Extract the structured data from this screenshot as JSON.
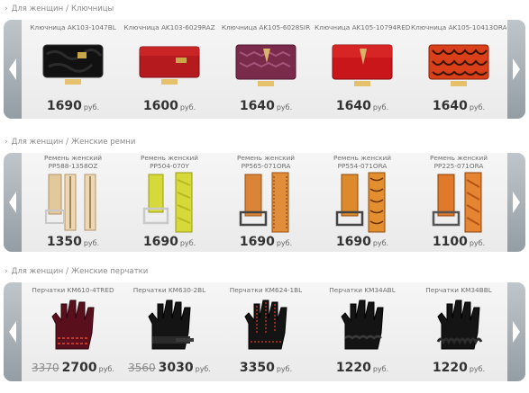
{
  "sections": [
    {
      "breadcrumb": [
        "Для женщин",
        "Ключницы"
      ],
      "items": [
        {
          "name": "Ключница AK103-1047BL",
          "price": "1690",
          "currency": "руб."
        },
        {
          "name": "Ключница AK103-6029RAZ",
          "price": "1600",
          "currency": "руб."
        },
        {
          "name": "Ключница AK105-6028SIR",
          "price": "1640",
          "currency": "руб."
        },
        {
          "name": "Ключница AK105-10794RED",
          "price": "1640",
          "currency": "руб."
        },
        {
          "name": "Ключница AK105-10413ORA",
          "price": "1640",
          "currency": "руб."
        }
      ]
    },
    {
      "breadcrumb": [
        "Для женщин",
        "Женские ремни"
      ],
      "items": [
        {
          "name1": "Ремень женский",
          "name2": "PP588-1358OZ",
          "price": "1350",
          "currency": "руб."
        },
        {
          "name1": "Ремень женский",
          "name2": "PP504-070Y",
          "price": "1690",
          "currency": "руб."
        },
        {
          "name1": "Ремень женский",
          "name2": "PP565-071ORA",
          "price": "1690",
          "currency": "руб."
        },
        {
          "name1": "Ремень женский",
          "name2": "PP554-071ORA",
          "price": "1690",
          "currency": "руб."
        },
        {
          "name1": "Ремень женский",
          "name2": "PP225-071ORA",
          "price": "1100",
          "currency": "руб."
        }
      ]
    },
    {
      "breadcrumb": [
        "Для женщин",
        "Женские перчатки"
      ],
      "items": [
        {
          "name": "Перчатки KM610-4TRED",
          "old_price": "3370",
          "price": "2700",
          "currency": "руб."
        },
        {
          "name": "Перчатки KM630-2BL",
          "old_price": "3560",
          "price": "3030",
          "currency": "руб."
        },
        {
          "name": "Перчатки KM624-1BL",
          "price": "3350",
          "currency": "руб."
        },
        {
          "name": "Перчатки KM34ABL",
          "price": "1220",
          "currency": "руб."
        },
        {
          "name": "Перчатки KM34BBL",
          "price": "1220",
          "currency": "руб."
        }
      ]
    }
  ],
  "icons": {
    "arrow_left": "chevron-left-icon",
    "arrow_right": "chevron-right-icon"
  },
  "colors": {
    "wallet_black": "#111111",
    "wallet_red": "#b51a1e",
    "wallet_purple": "#7a2a4a",
    "wallet_orange": "#d9401a",
    "belt_tan": "#e3b57d",
    "belt_yellow": "#d6d93a",
    "belt_orange": "#e07a2a",
    "glove_burgundy": "#5a0f1c",
    "glove_black": "#141414"
  }
}
